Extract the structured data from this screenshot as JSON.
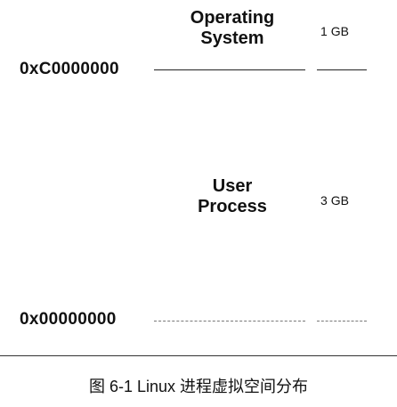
{
  "regions": {
    "operating_system": {
      "line1": "Operating",
      "line2": "System",
      "size": "1 GB"
    },
    "user_process": {
      "line1": "User",
      "line2": "Process",
      "size": "3 GB"
    }
  },
  "addresses": {
    "kernel_boundary": "0xC0000000",
    "base": "0x00000000"
  },
  "caption": "图 6-1   Linux 进程虚拟空间分布"
}
